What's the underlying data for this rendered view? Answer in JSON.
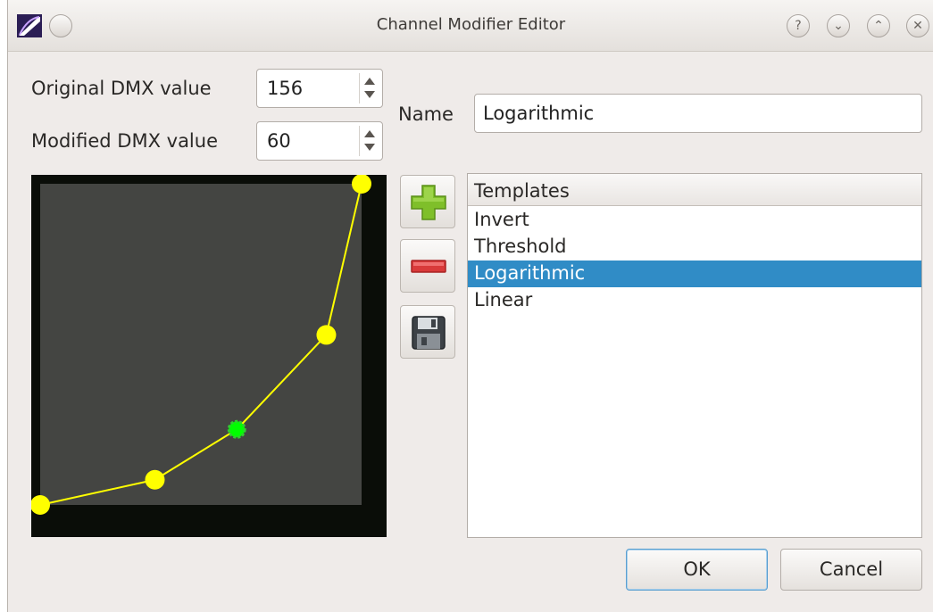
{
  "window": {
    "title": "Channel Modifier Editor",
    "controls": [
      "help-icon",
      "minimize-icon",
      "maximize-icon",
      "close-icon"
    ]
  },
  "original_dmx": {
    "label": "Original DMX value",
    "value": "156"
  },
  "modified_dmx": {
    "label": "Modified DMX value",
    "value": "60"
  },
  "name": {
    "label": "Name",
    "value": "Logarithmic"
  },
  "curve": {
    "handle_color": "#ffff00",
    "selected_handle_color": "#00ff00",
    "points": [
      {
        "original": 0,
        "modified": 0
      },
      {
        "original": 91,
        "modified": 20
      },
      {
        "original": 156,
        "modified": 60
      },
      {
        "original": 227,
        "modified": 135
      },
      {
        "original": 255,
        "modified": 255
      }
    ],
    "selected_index": 2
  },
  "toolbar": {
    "add_icon": "plus-icon",
    "remove_icon": "minus-icon",
    "save_icon": "floppy-disk-icon"
  },
  "templates": {
    "header": "Templates",
    "items": [
      "Invert",
      "Threshold",
      "Logarithmic",
      "Linear"
    ],
    "selected": "Logarithmic",
    "selection_color": "#308cc6"
  },
  "buttons": {
    "ok": "OK",
    "cancel": "Cancel"
  }
}
